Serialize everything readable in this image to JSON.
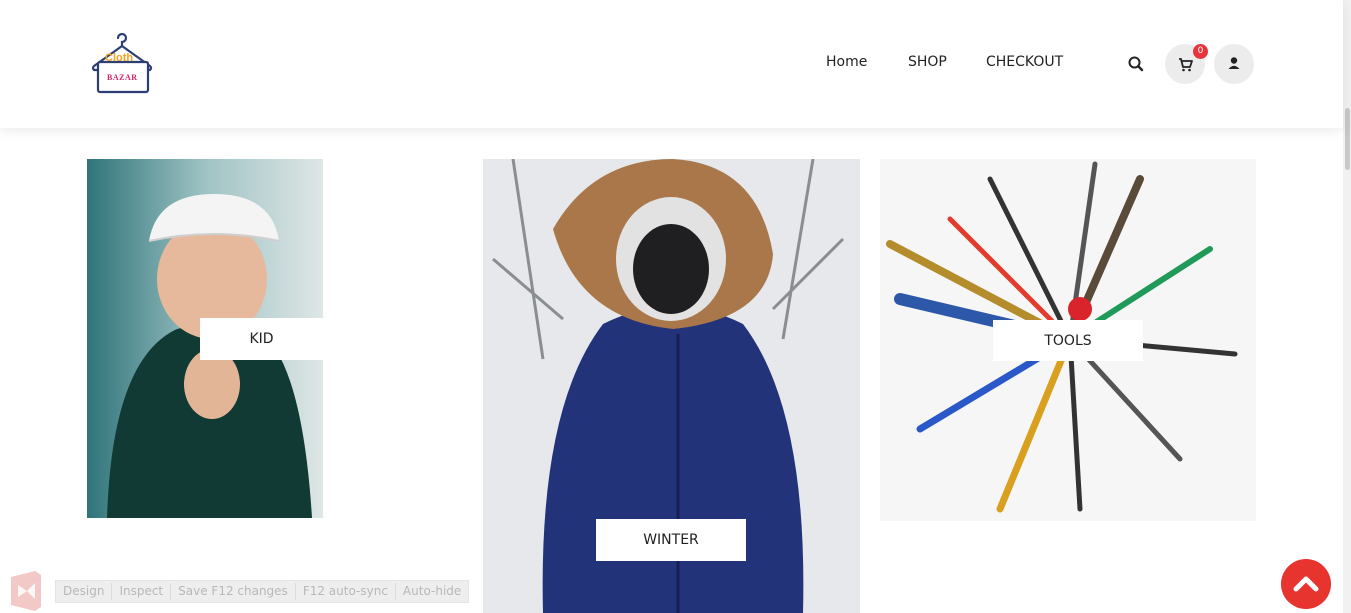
{
  "brand": {
    "logo_top": "Cloth",
    "logo_bottom": "BAZAR"
  },
  "nav": {
    "home": "Home",
    "shop": "SHOP",
    "checkout": "CHECKOUT"
  },
  "cart": {
    "count": "0"
  },
  "categories": [
    {
      "label": "KID"
    },
    {
      "label": "WINTER"
    },
    {
      "label": "TOOLS"
    }
  ],
  "devbar": [
    "Design",
    "Inspect",
    "Save F12 changes",
    "F12 auto-sync",
    "Auto-hide"
  ],
  "colors": {
    "accent": "#e8342f",
    "badge": "#e8343b",
    "logo_orange": "#f0a21e",
    "logo_pink": "#d1246a",
    "logo_navy": "#2c3e73"
  }
}
